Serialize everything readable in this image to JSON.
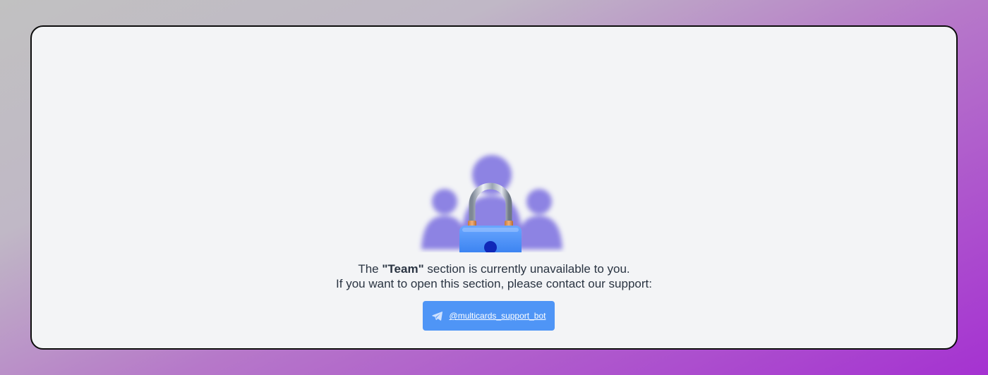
{
  "message": {
    "line1_prefix": "The ",
    "section_name": "\"Team\"",
    "line1_suffix": " section is currently unavailable to you.",
    "line2": "If you want to open this section, please contact our support:"
  },
  "support": {
    "label": "@multicards_support_bot",
    "icon": "telegram-icon"
  },
  "illustration": {
    "icon": "locked-team-icon"
  },
  "colors": {
    "button": "#4f95f6",
    "card_bg": "#f3f4f6",
    "text": "#2a3442",
    "people": "#7b6fe0",
    "lock_body": "#3f86f2"
  }
}
